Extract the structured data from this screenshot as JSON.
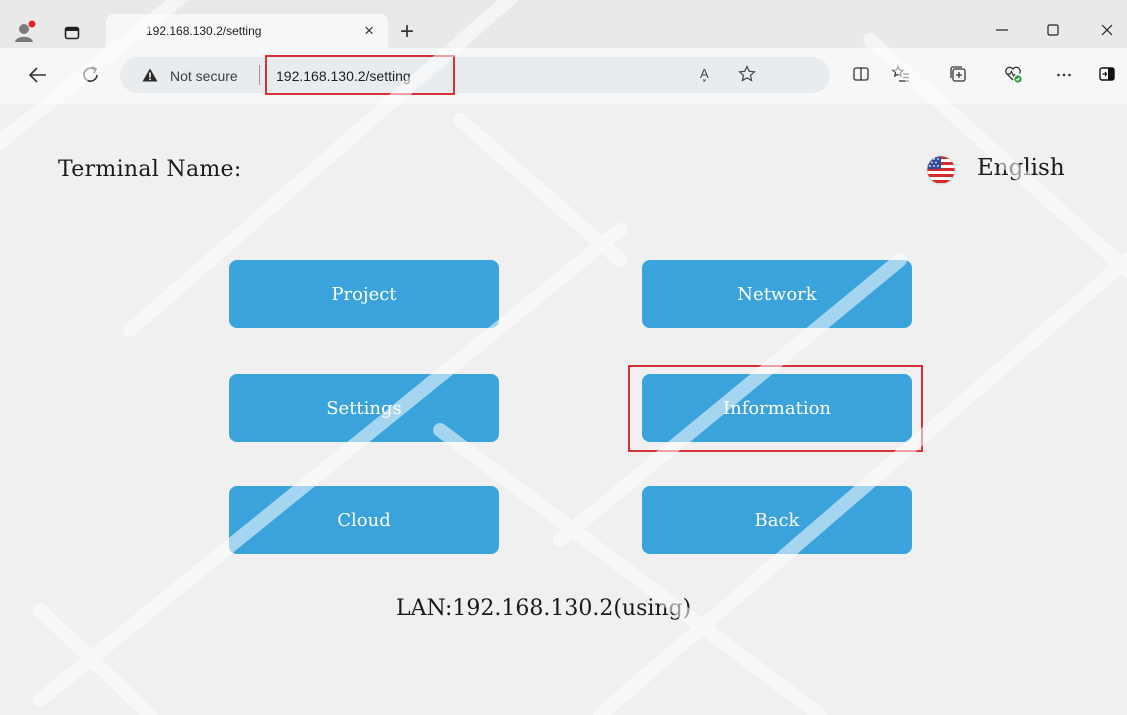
{
  "browser": {
    "tab_title": "192.168.130.2/setting",
    "tab_close": "×",
    "new_tab": "+",
    "security_label": "Not secure",
    "url": "192.168.130.2/setting",
    "read_aloud": "A͓"
  },
  "icons": {
    "profile": "profile-icon",
    "tab_actions": "tab-actions-icon",
    "back": "back-arrow-icon",
    "reload": "reload-icon",
    "warning": "warning-icon",
    "favorite": "star-icon",
    "split_screen": "split-screen-icon",
    "favorites": "favorites-list-icon",
    "collections": "collections-icon",
    "browser_essentials": "heart-pulse-icon",
    "more": "more-icon",
    "sidebar": "sidebar-toggle-icon",
    "flag": "us-flag-icon"
  },
  "page": {
    "terminal_label": "Terminal Name:",
    "language": "English",
    "buttons": {
      "project": "Project",
      "network": "Network",
      "settings": "Settings",
      "information": "Information",
      "cloud": "Cloud",
      "back": "Back"
    },
    "lan_status": "LAN:192.168.130.2(using)"
  },
  "colors": {
    "button_bg": "#3aa3dc",
    "highlight": "#d5323a",
    "page_bg": "#f0f0f0"
  }
}
